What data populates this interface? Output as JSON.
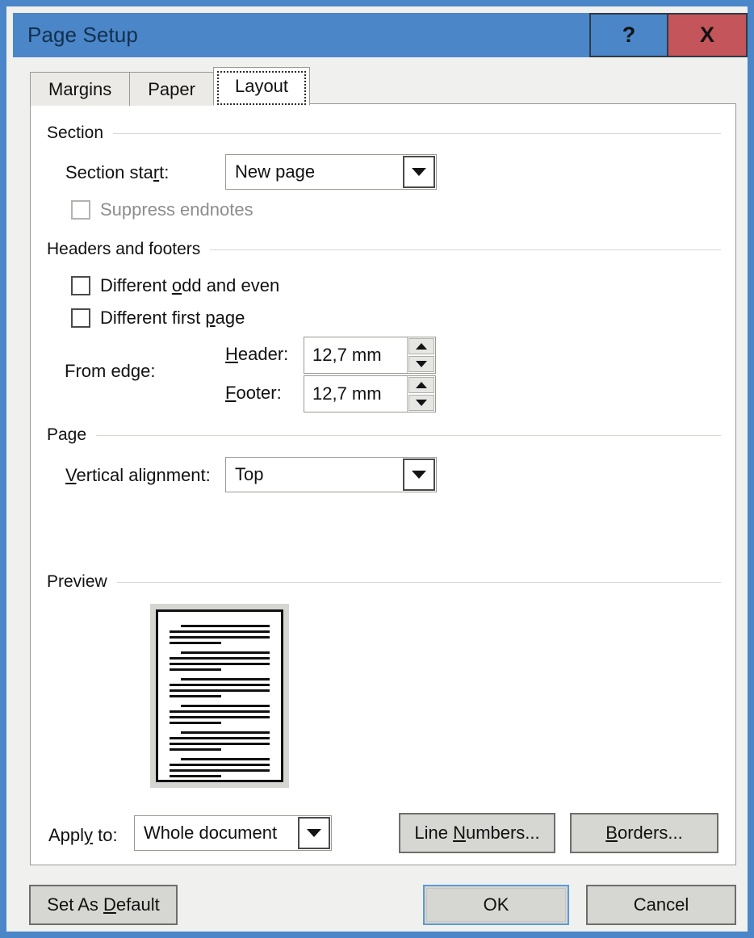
{
  "window": {
    "title": "Page Setup",
    "help_label": "?",
    "close_label": "X",
    "titlebar_color": "#4a86c8",
    "close_color": "#c4555a"
  },
  "tabs": [
    {
      "label": "Margins",
      "active": false
    },
    {
      "label": "Paper",
      "active": false
    },
    {
      "label": "Layout",
      "active": true
    }
  ],
  "groups": {
    "section": {
      "label": "Section"
    },
    "headers_footers": {
      "label": "Headers and footers"
    },
    "page": {
      "label": "Page"
    },
    "preview": {
      "label": "Preview"
    }
  },
  "section": {
    "start_label_pre": "Section sta",
    "start_label_accel": "r",
    "start_label_post": "t:",
    "start_value": "New page",
    "suppress_endnotes_label": "Suppress endnotes",
    "suppress_endnotes_checked": false,
    "suppress_endnotes_disabled": true
  },
  "headers_footers": {
    "diff_odd_even_pre": "Different ",
    "diff_odd_even_accel": "o",
    "diff_odd_even_post": "dd and even",
    "diff_odd_even_checked": false,
    "diff_first_pre": "Different first ",
    "diff_first_accel": "p",
    "diff_first_post": "age",
    "diff_first_checked": false,
    "from_edge_label": "From edge:",
    "header_label_accel": "H",
    "header_label_post": "eader:",
    "header_value": "12,7 mm",
    "footer_label_accel": "F",
    "footer_label_post": "ooter:",
    "footer_value": "12,7 mm"
  },
  "page": {
    "valign_label_accel": "V",
    "valign_label_post": "ertical alignment:",
    "valign_value": "Top"
  },
  "bottom": {
    "apply_to_pre": "Appl",
    "apply_to_accel": "y",
    "apply_to_post": " to:",
    "apply_to_value": "Whole document",
    "line_numbers_pre": "Line ",
    "line_numbers_accel": "N",
    "line_numbers_post": "umbers...",
    "borders_accel": "B",
    "borders_post": "orders..."
  },
  "footer_buttons": {
    "set_default_pre": "Set As ",
    "set_default_accel": "D",
    "set_default_post": "efault",
    "ok_label": "OK",
    "cancel_label": "Cancel"
  },
  "preview_doc": {
    "paragraph_count": 6,
    "lines_per_paragraph": [
      "indent",
      "full",
      "full",
      "short"
    ]
  }
}
